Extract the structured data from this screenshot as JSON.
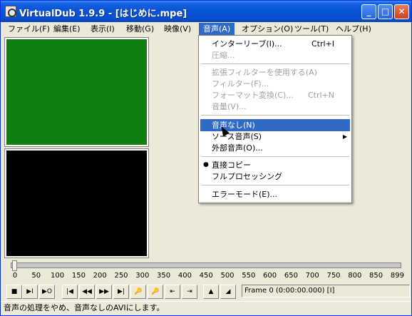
{
  "window": {
    "title": "VirtualDub 1.9.9 - [はじめに.mpe]",
    "controls": {
      "minimize": "_",
      "maximize": "□",
      "close": "✕"
    }
  },
  "menubar": {
    "items": [
      {
        "label": "ファイル(F)"
      },
      {
        "label": "編集(E)"
      },
      {
        "label": "表示(I)"
      },
      {
        "label": "移動(G)"
      },
      {
        "label": "映像(V)"
      },
      {
        "label": "音声(A)"
      },
      {
        "label": "オプション(O)"
      },
      {
        "label": "ツール(T)"
      },
      {
        "label": "ヘルプ(H)"
      }
    ]
  },
  "audio_menu": {
    "items": [
      {
        "label": "インターリーブ(I)...",
        "shortcut": "Ctrl+I"
      },
      {
        "label": "圧縮..."
      },
      {
        "label": "拡張フィルターを使用する(A)"
      },
      {
        "label": "フィルター(F)..."
      },
      {
        "label": "フォーマット変換(C)...",
        "shortcut": "Ctrl+N"
      },
      {
        "label": "音量(V)..."
      },
      {
        "label": "音声なし(N)"
      },
      {
        "label": "ソース音声(S)",
        "submenu": "▶"
      },
      {
        "label": "外部音声(O)..."
      },
      {
        "label": "直接コピー",
        "bullet": "●"
      },
      {
        "label": "フルプロセッシング"
      },
      {
        "label": "エラーモード(E)..."
      }
    ]
  },
  "timeline": {
    "ticks": [
      "0",
      "50",
      "100",
      "150",
      "200",
      "250",
      "300",
      "350",
      "400",
      "450",
      "500",
      "550",
      "600",
      "650",
      "700",
      "750",
      "800",
      "850",
      "899"
    ],
    "position_fraction": 0
  },
  "toolbar": {
    "buttons": [
      {
        "name": "stop-button",
        "glyph": "■"
      },
      {
        "name": "play-input-button",
        "glyph": "▶I"
      },
      {
        "name": "play-output-button",
        "glyph": "▶O"
      },
      {
        "name": "go-start-button",
        "glyph": "|◀"
      },
      {
        "name": "step-back-button",
        "glyph": "◀◀"
      },
      {
        "name": "step-forward-button",
        "glyph": "▶▶"
      },
      {
        "name": "go-end-button",
        "glyph": "▶|"
      },
      {
        "name": "prev-key-button",
        "glyph": "🔑"
      },
      {
        "name": "next-key-button",
        "glyph": "🔑"
      },
      {
        "name": "prev-scene-button",
        "glyph": "⇤"
      },
      {
        "name": "next-scene-button",
        "glyph": "⇥"
      },
      {
        "name": "mark-in-button",
        "glyph": "▲"
      },
      {
        "name": "mark-out-button",
        "glyph": "◢"
      }
    ],
    "frame_readout": "Frame 0 (0:00:00.000) [I]"
  },
  "status": {
    "text": "音声の処理をやめ、音声なしのAVIにします。"
  },
  "colors": {
    "input_pane": "#117e11",
    "output_pane": "#000000",
    "highlight": "#316ac5"
  }
}
